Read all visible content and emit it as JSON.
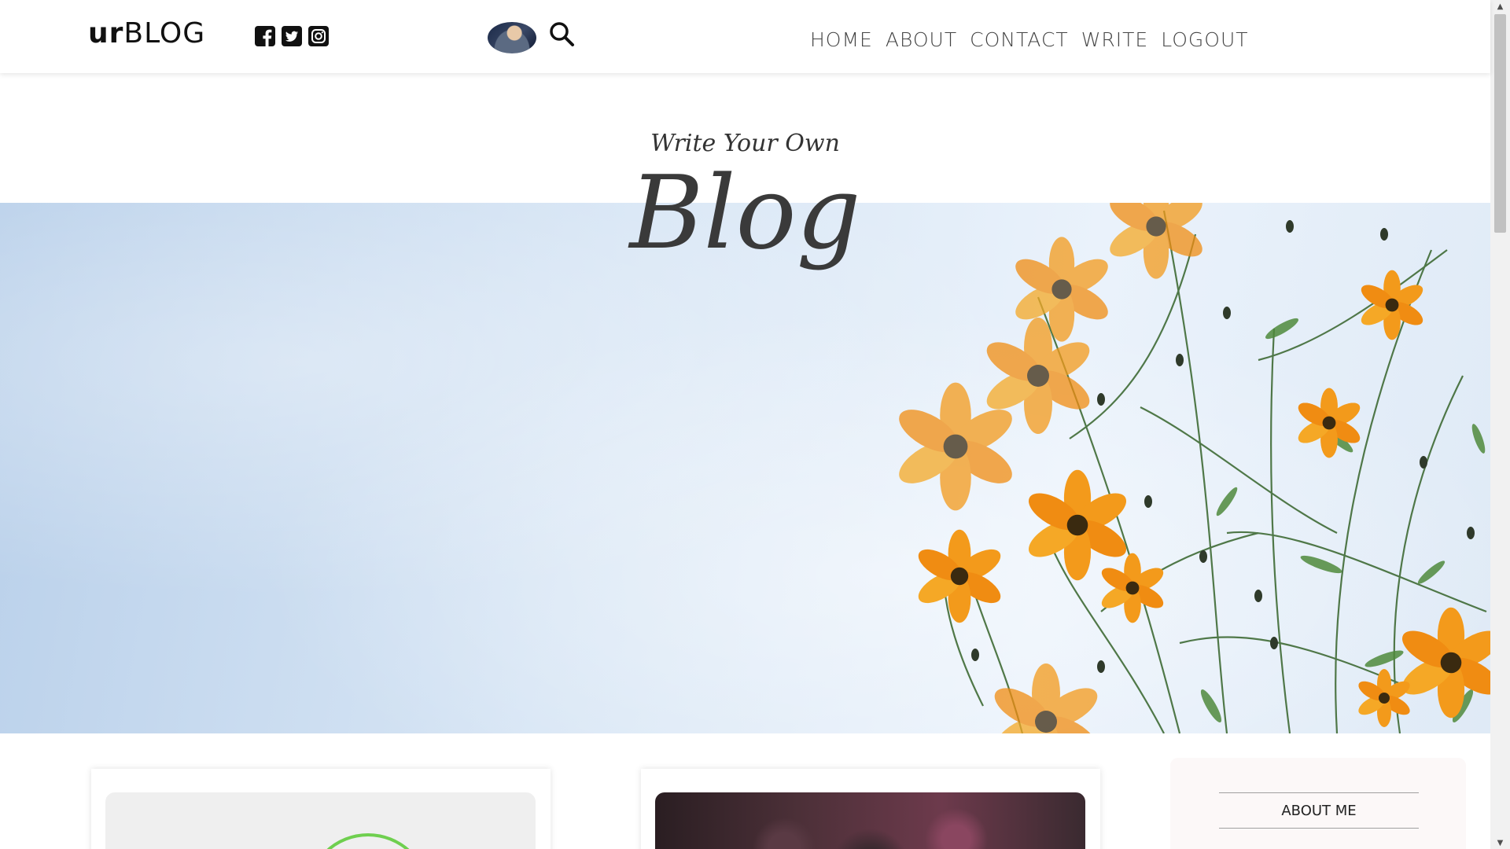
{
  "header": {
    "logo_a": "ur",
    "logo_b": "BLOG",
    "social_icons": [
      "facebook-square-icon",
      "twitter-square-icon",
      "instagram-icon"
    ],
    "nav": [
      "HOME",
      "ABOUT",
      "CONTACT",
      "WRITE",
      "LOGOUT"
    ]
  },
  "hero": {
    "subtitle": "Write Your Own",
    "title": "Blog"
  },
  "sidebar": {
    "title": "ABOUT ME"
  },
  "colors": {
    "flower": "#f39a1b",
    "stem": "#3f6b35",
    "sky": "#d8e6f5"
  }
}
